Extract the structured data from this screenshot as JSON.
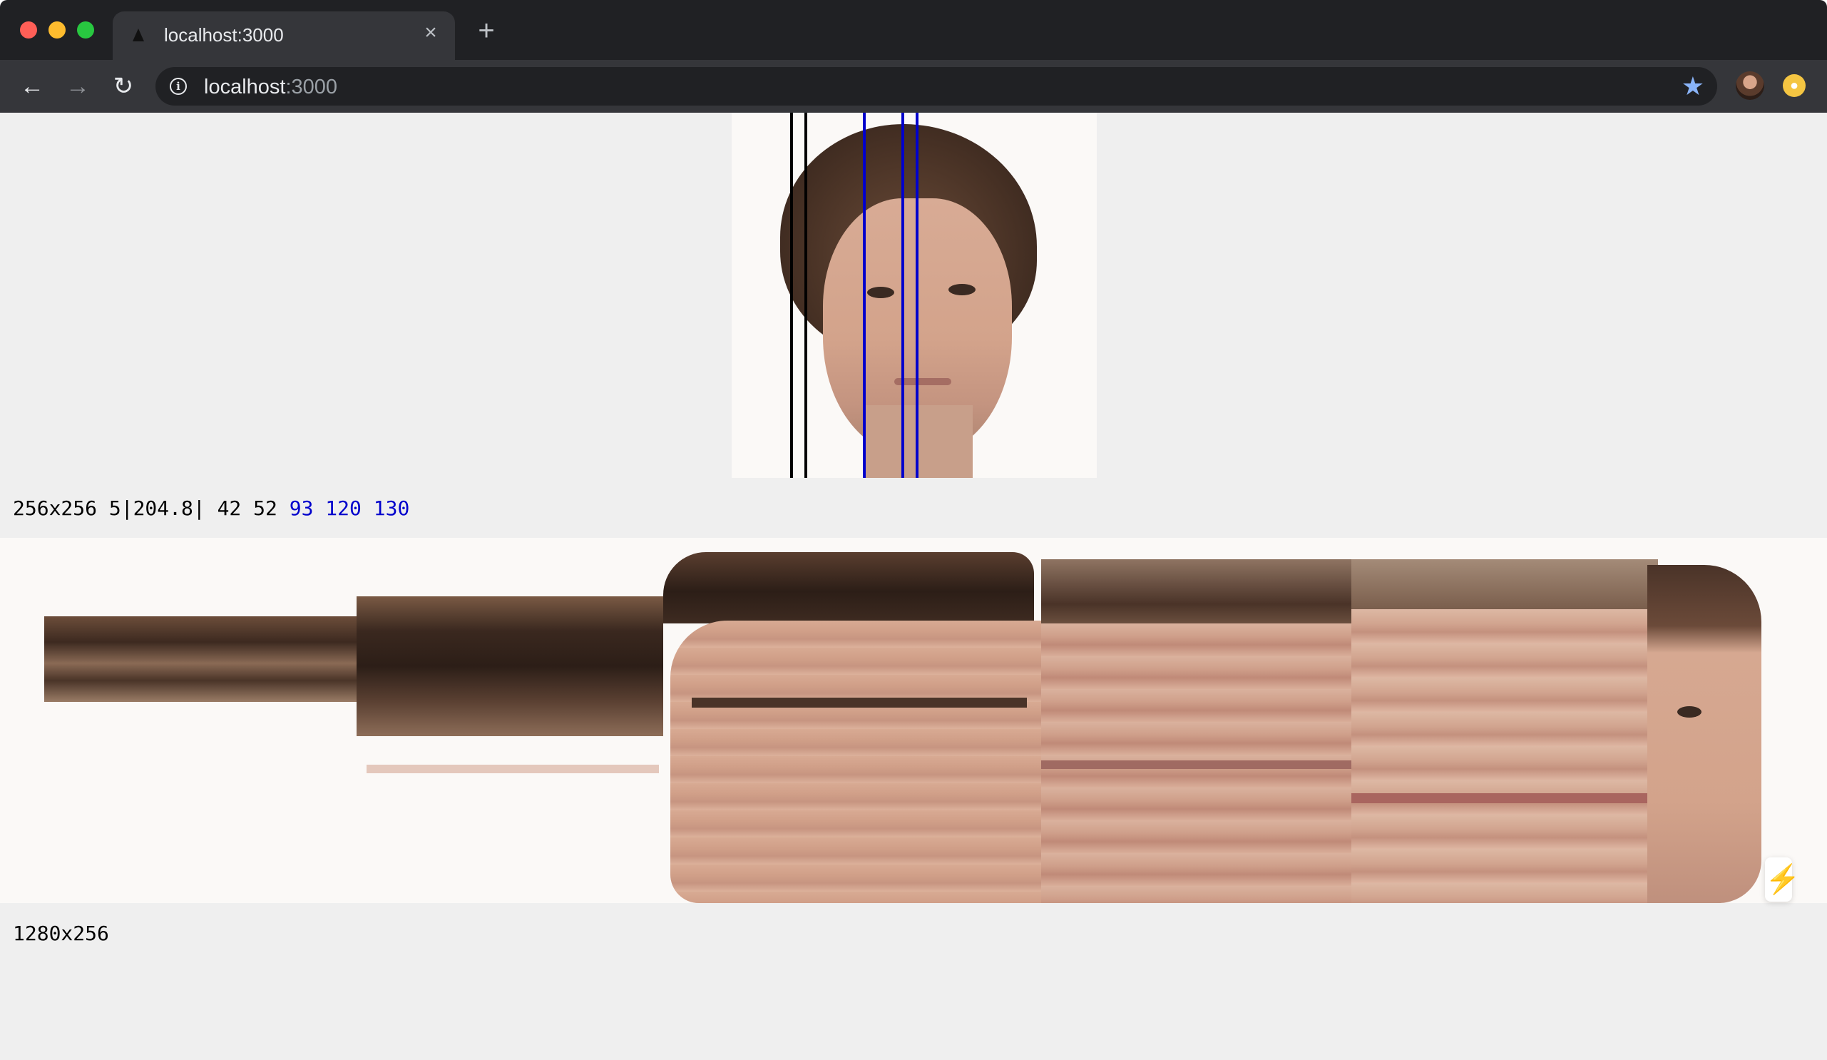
{
  "browser": {
    "tab": {
      "title": "localhost:3000",
      "close_glyph": "×"
    },
    "new_tab_glyph": "+",
    "nav": {
      "back_glyph": "←",
      "forward_glyph": "→",
      "reload_glyph": "↻"
    },
    "address": {
      "host": "localhost",
      "port": ":3000",
      "info_glyph": "i",
      "star_glyph": "★"
    },
    "extension_glyph": "●"
  },
  "source": {
    "caption_main": "256x256 5|204.8| 42 52 ",
    "caption_highlight": "93 120 130",
    "line_color_black": "#000000",
    "line_color_blue": "#0000cc"
  },
  "output": {
    "caption": "1280x256"
  },
  "devtools": {
    "glyph": "⚡"
  }
}
